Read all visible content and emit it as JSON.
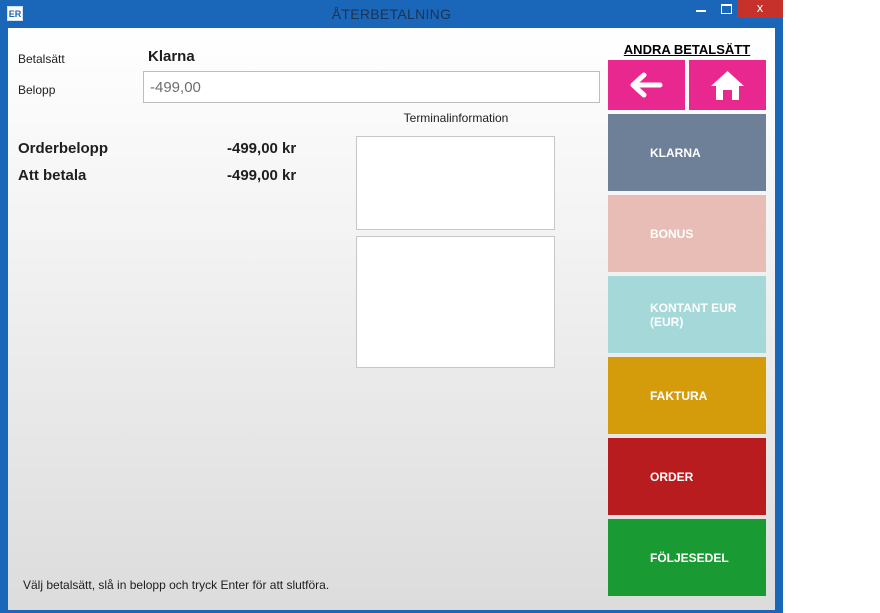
{
  "window": {
    "app_icon": "ER",
    "title": "ÅTERBETALNING",
    "close_glyph": "x"
  },
  "form": {
    "method_label": "Betalsätt",
    "method_value": "Klarna",
    "amount_label": "Belopp",
    "amount_value": "-499,00"
  },
  "summary": {
    "order_label": "Orderbelopp",
    "order_value": "-499,00 kr",
    "pay_label": "Att betala",
    "pay_value": "-499,00 kr"
  },
  "terminal": {
    "title": "Terminalinformation"
  },
  "footer": {
    "hint": "Välj betalsätt, slå in belopp och tryck Enter för att slutföra."
  },
  "sidebar": {
    "title": "ANDRA BETALSÄTT",
    "nav": {
      "back_icon": "arrow-left-icon",
      "home_icon": "home-icon",
      "color": "#e8288f"
    },
    "methods": [
      {
        "label": "KLARNA",
        "color": "#6e7f98"
      },
      {
        "label": "BONUS",
        "color": "#e7bdb6"
      },
      {
        "label": "KONTANT EUR (EUR)",
        "color": "#a5d8d8"
      },
      {
        "label": "FAKTURA",
        "color": "#d49c0a"
      },
      {
        "label": "ORDER",
        "color": "#b81c1f"
      },
      {
        "label": "FÖLJESEDEL",
        "color": "#1a9a33"
      }
    ]
  }
}
